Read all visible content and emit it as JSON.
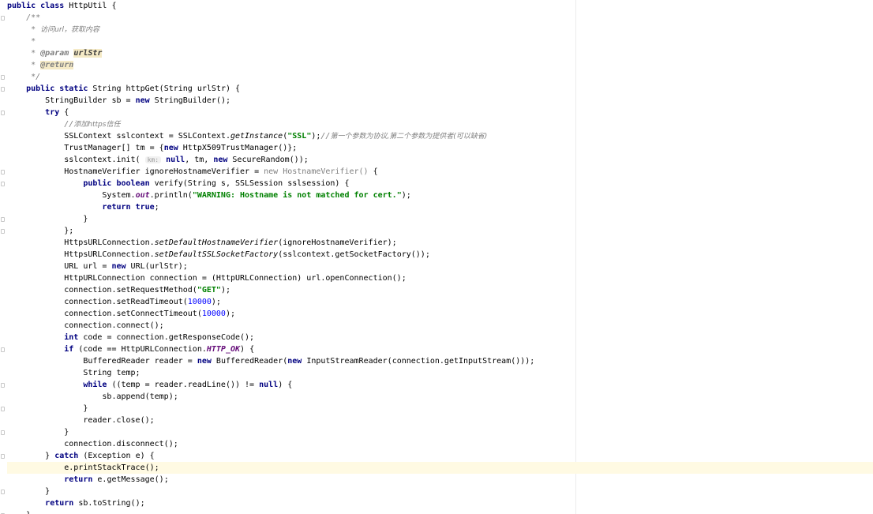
{
  "editor": {
    "lines": [
      [
        [
          "public class ",
          "k"
        ],
        [
          "HttpUtil {",
          ""
        ]
      ],
      [
        [
          "    /**",
          "c"
        ]
      ],
      [
        [
          "     * ",
          "c"
        ],
        [
          "访问url，获取内容",
          "cz"
        ]
      ],
      [
        [
          "     *",
          "c"
        ]
      ],
      [
        [
          "     * ",
          "c"
        ],
        [
          "@param",
          "dt"
        ],
        [
          " ",
          "c"
        ],
        [
          "urlStr",
          "dp"
        ]
      ],
      [
        [
          "     * ",
          "c"
        ],
        [
          "@return",
          "dth"
        ]
      ],
      [
        [
          "     */",
          "c"
        ]
      ],
      [
        [
          "    ",
          ""
        ],
        [
          "public static ",
          "k"
        ],
        [
          "String httpGet(String urlStr) {",
          ""
        ]
      ],
      [
        [
          "        StringBuilder sb = ",
          ""
        ],
        [
          "new ",
          "k"
        ],
        [
          "StringBuilder();",
          ""
        ]
      ],
      [
        [
          "        ",
          ""
        ],
        [
          "try ",
          "k"
        ],
        [
          "{",
          ""
        ]
      ],
      [
        [
          "            ",
          ""
        ],
        [
          "//",
          "c"
        ],
        [
          "添加https信任",
          "cz"
        ]
      ],
      [
        [
          "            SSLContext sslcontext = SSLContext.",
          ""
        ],
        [
          "getInstance",
          "it"
        ],
        [
          "(",
          ""
        ],
        [
          "\"SSL\"",
          "s"
        ],
        [
          ");",
          ""
        ],
        [
          "//",
          "c"
        ],
        [
          "第一个参数为协议,第二个参数为提供者(可以缺省)",
          "cz"
        ]
      ],
      [
        [
          "            TrustManager[] tm = {",
          ""
        ],
        [
          "new ",
          "k"
        ],
        [
          "HttpX509TrustManager()};",
          ""
        ]
      ],
      [
        [
          "            sslcontext.init( ",
          ""
        ],
        [
          "km:",
          "hint"
        ],
        [
          " ",
          ""
        ],
        [
          "null",
          "k"
        ],
        [
          ", tm, ",
          ""
        ],
        [
          "new ",
          "k"
        ],
        [
          "SecureRandom());",
          ""
        ]
      ],
      [
        [
          "            HostnameVerifier ignoreHostnameVerifier = ",
          ""
        ],
        [
          "new HostnameVerifier() ",
          "g"
        ],
        [
          "{",
          ""
        ]
      ],
      [
        [
          "                ",
          ""
        ],
        [
          "public boolean ",
          "k"
        ],
        [
          "verify(String s, SSLSession sslsession) {",
          ""
        ]
      ],
      [
        [
          "                    System.",
          ""
        ],
        [
          "out",
          "f"
        ],
        [
          ".println(",
          ""
        ],
        [
          "\"WARNING: Hostname is not matched for cert.\"",
          "s"
        ],
        [
          ");",
          ""
        ]
      ],
      [
        [
          "                    ",
          ""
        ],
        [
          "return true",
          "k"
        ],
        [
          ";",
          ""
        ]
      ],
      [
        [
          "                }",
          ""
        ]
      ],
      [
        [
          "            };",
          ""
        ]
      ],
      [
        [
          "            HttpsURLConnection.",
          ""
        ],
        [
          "setDefaultHostnameVerifier",
          "it"
        ],
        [
          "(ignoreHostnameVerifier);",
          ""
        ]
      ],
      [
        [
          "            HttpsURLConnection.",
          ""
        ],
        [
          "setDefaultSSLSocketFactory",
          "it"
        ],
        [
          "(sslcontext.getSocketFactory());",
          ""
        ]
      ],
      [
        [
          "            URL url = ",
          ""
        ],
        [
          "new ",
          "k"
        ],
        [
          "URL(urlStr);",
          ""
        ]
      ],
      [
        [
          "            HttpURLConnection connection = (HttpURLConnection) url.openConnection();",
          ""
        ]
      ],
      [
        [
          "            connection.setRequestMethod(",
          ""
        ],
        [
          "\"GET\"",
          "s"
        ],
        [
          ");",
          ""
        ]
      ],
      [
        [
          "            connection.setReadTimeout(",
          ""
        ],
        [
          "10000",
          "n"
        ],
        [
          ");",
          ""
        ]
      ],
      [
        [
          "            connection.setConnectTimeout(",
          ""
        ],
        [
          "10000",
          "n"
        ],
        [
          ");",
          ""
        ]
      ],
      [
        [
          "            connection.connect();",
          ""
        ]
      ],
      [
        [
          "            ",
          ""
        ],
        [
          "int ",
          "k"
        ],
        [
          "code = connection.getResponseCode();",
          ""
        ]
      ],
      [
        [
          "            ",
          ""
        ],
        [
          "if ",
          "k"
        ],
        [
          "(code == HttpURLConnection.",
          ""
        ],
        [
          "HTTP_OK",
          "f"
        ],
        [
          ") {",
          ""
        ]
      ],
      [
        [
          "                BufferedReader reader = ",
          ""
        ],
        [
          "new ",
          "k"
        ],
        [
          "BufferedReader(",
          ""
        ],
        [
          "new ",
          "k"
        ],
        [
          "InputStreamReader(connection.getInputStream()));",
          ""
        ]
      ],
      [
        [
          "                String temp;",
          ""
        ]
      ],
      [
        [
          "                ",
          ""
        ],
        [
          "while ",
          "k"
        ],
        [
          "((temp = reader.readLine()) != ",
          ""
        ],
        [
          "null",
          "k"
        ],
        [
          ") {",
          ""
        ]
      ],
      [
        [
          "                    sb.append(temp);",
          ""
        ]
      ],
      [
        [
          "                }",
          ""
        ]
      ],
      [
        [
          "                reader.close();",
          ""
        ]
      ],
      [
        [
          "            }",
          ""
        ]
      ],
      [
        [
          "            connection.disconnect();",
          ""
        ]
      ],
      [
        [
          "        } ",
          ""
        ],
        [
          "catch ",
          "k"
        ],
        [
          "(Exception e) {",
          ""
        ]
      ],
      [
        [
          "            e.printStackTrace();",
          ""
        ]
      ],
      [
        [
          "            ",
          ""
        ],
        [
          "return ",
          "k"
        ],
        [
          "e.getMessage();",
          ""
        ]
      ],
      [
        [
          "        }",
          ""
        ]
      ],
      [
        [
          "        ",
          ""
        ],
        [
          "return ",
          "k"
        ],
        [
          "sb.toString();",
          ""
        ]
      ],
      [
        [
          "    }",
          ""
        ]
      ]
    ],
    "highlighted_line": 39,
    "fold_markers": [
      {
        "line": 1,
        "name": "fold-marker-javadoc-start"
      },
      {
        "line": 6,
        "name": "fold-marker-javadoc-end"
      },
      {
        "line": 7,
        "name": "fold-marker-method-start"
      },
      {
        "line": 9,
        "name": "fold-marker-try-start"
      },
      {
        "line": 14,
        "name": "fold-marker-anonymous-class-start"
      },
      {
        "line": 15,
        "name": "fold-marker-verify-start"
      },
      {
        "line": 18,
        "name": "fold-marker-verify-end"
      },
      {
        "line": 19,
        "name": "fold-marker-anonymous-class-end"
      },
      {
        "line": 29,
        "name": "fold-marker-if-start"
      },
      {
        "line": 32,
        "name": "fold-marker-while-start"
      },
      {
        "line": 34,
        "name": "fold-marker-while-end"
      },
      {
        "line": 36,
        "name": "fold-marker-if-end"
      },
      {
        "line": 38,
        "name": "fold-marker-catch-start"
      },
      {
        "line": 41,
        "name": "fold-marker-catch-end"
      },
      {
        "line": 43,
        "name": "fold-marker-method-end"
      }
    ]
  }
}
